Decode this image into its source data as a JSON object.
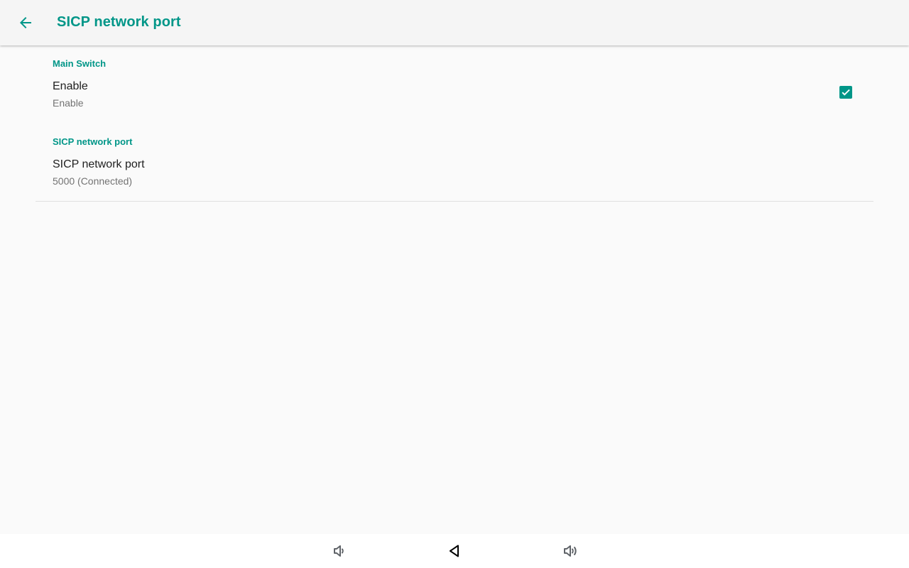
{
  "app_bar": {
    "title": "SICP network port",
    "back_icon": "arrow-back-icon"
  },
  "sections": [
    {
      "header": "Main Switch",
      "item": {
        "title": "Enable",
        "summary": "Enable",
        "checked": true
      }
    },
    {
      "header": "SICP network port",
      "item": {
        "title": "SICP network port",
        "summary": "5000 (Connected)"
      }
    }
  ],
  "nav_bar": {
    "buttons": [
      "volume-down-icon",
      "back-triangle-icon",
      "volume-up-icon"
    ]
  },
  "colors": {
    "accent": "#009688",
    "toolbar_bg": "#f5f5f5",
    "content_bg": "#fafafa",
    "nav_icon": "#5f6368"
  }
}
